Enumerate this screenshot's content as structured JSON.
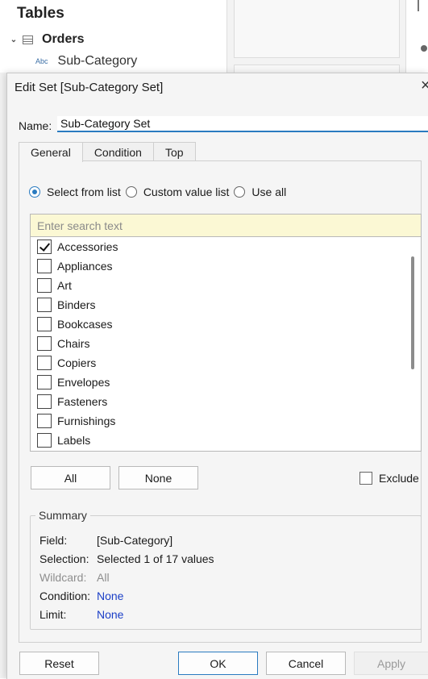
{
  "background": {
    "panel_title": "Tables",
    "table_name": "Orders",
    "field_type": "Abc",
    "field_name": "Sub-Category"
  },
  "dialog": {
    "title": "Edit Set [Sub-Category Set]",
    "close_glyph": "×"
  },
  "name": {
    "label": "Name:",
    "value": "Sub-Category Set"
  },
  "tabs": [
    "General",
    "Condition",
    "Top"
  ],
  "active_tab": "General",
  "radios": [
    {
      "label": "Select from list",
      "selected": true
    },
    {
      "label": "Custom value list",
      "selected": false
    },
    {
      "label": "Use all",
      "selected": false
    }
  ],
  "search": {
    "placeholder": "Enter search text",
    "value": ""
  },
  "list_items": [
    {
      "label": "Accessories",
      "checked": true
    },
    {
      "label": "Appliances",
      "checked": false
    },
    {
      "label": "Art",
      "checked": false
    },
    {
      "label": "Binders",
      "checked": false
    },
    {
      "label": "Bookcases",
      "checked": false
    },
    {
      "label": "Chairs",
      "checked": false
    },
    {
      "label": "Copiers",
      "checked": false
    },
    {
      "label": "Envelopes",
      "checked": false
    },
    {
      "label": "Fasteners",
      "checked": false
    },
    {
      "label": "Furnishings",
      "checked": false
    },
    {
      "label": "Labels",
      "checked": false
    }
  ],
  "list_buttons": {
    "all": "All",
    "none": "None"
  },
  "exclude": {
    "label": "Exclude",
    "checked": false
  },
  "summary": {
    "title": "Summary",
    "rows": [
      {
        "key": "Field:",
        "value": "[Sub-Category]",
        "dim": false,
        "link": false
      },
      {
        "key": "Selection:",
        "value": "Selected 1 of 17 values",
        "dim": false,
        "link": false
      },
      {
        "key": "Wildcard:",
        "value": "All",
        "dim": true,
        "link": false
      },
      {
        "key": "Condition:",
        "value": "None",
        "dim": false,
        "link": true
      },
      {
        "key": "Limit:",
        "value": "None",
        "dim": false,
        "link": true
      }
    ]
  },
  "footer": {
    "reset": "Reset",
    "ok": "OK",
    "cancel": "Cancel",
    "apply": "Apply",
    "apply_enabled": false
  },
  "colors": {
    "accent": "#2a7bc0",
    "link": "#1b3fc7",
    "search_bg": "#fbf8d4"
  }
}
